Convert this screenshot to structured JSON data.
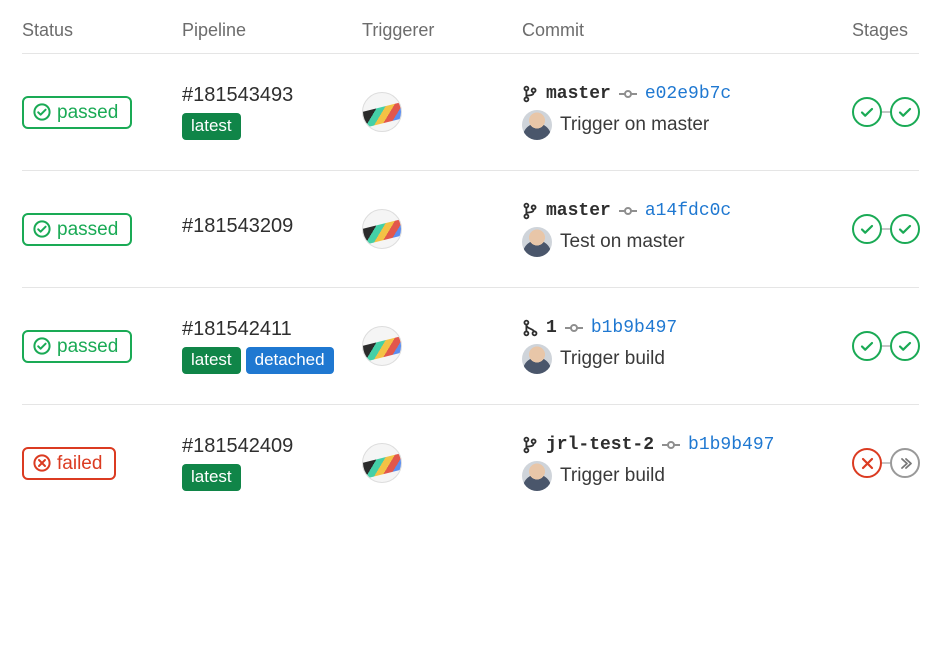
{
  "columns": {
    "status": "Status",
    "pipeline": "Pipeline",
    "triggerer": "Triggerer",
    "commit": "Commit",
    "stages": "Stages"
  },
  "status_labels": {
    "passed": "passed",
    "failed": "failed"
  },
  "tag_labels": {
    "latest": "latest",
    "detached": "detached"
  },
  "pipelines": [
    {
      "status": "passed",
      "id": "#181543493",
      "tags": [
        "latest"
      ],
      "branch": "master",
      "branch_icon": "branch",
      "sha": "e02e9b7c",
      "message": "Trigger on master",
      "stages": [
        "passed",
        "passed"
      ]
    },
    {
      "status": "passed",
      "id": "#181543209",
      "tags": [],
      "branch": "master",
      "branch_icon": "branch",
      "sha": "a14fdc0c",
      "message": "Test on master",
      "stages": [
        "passed",
        "passed"
      ]
    },
    {
      "status": "passed",
      "id": "#181542411",
      "tags": [
        "latest",
        "detached"
      ],
      "branch": "1",
      "branch_icon": "merge",
      "sha": "b1b9b497",
      "message": "Trigger build",
      "stages": [
        "passed",
        "passed"
      ]
    },
    {
      "status": "failed",
      "id": "#181542409",
      "tags": [
        "latest"
      ],
      "branch": "jrl-test-2",
      "branch_icon": "branch",
      "sha": "b1b9b497",
      "message": "Trigger build",
      "stages": [
        "failed",
        "skipped"
      ]
    }
  ]
}
